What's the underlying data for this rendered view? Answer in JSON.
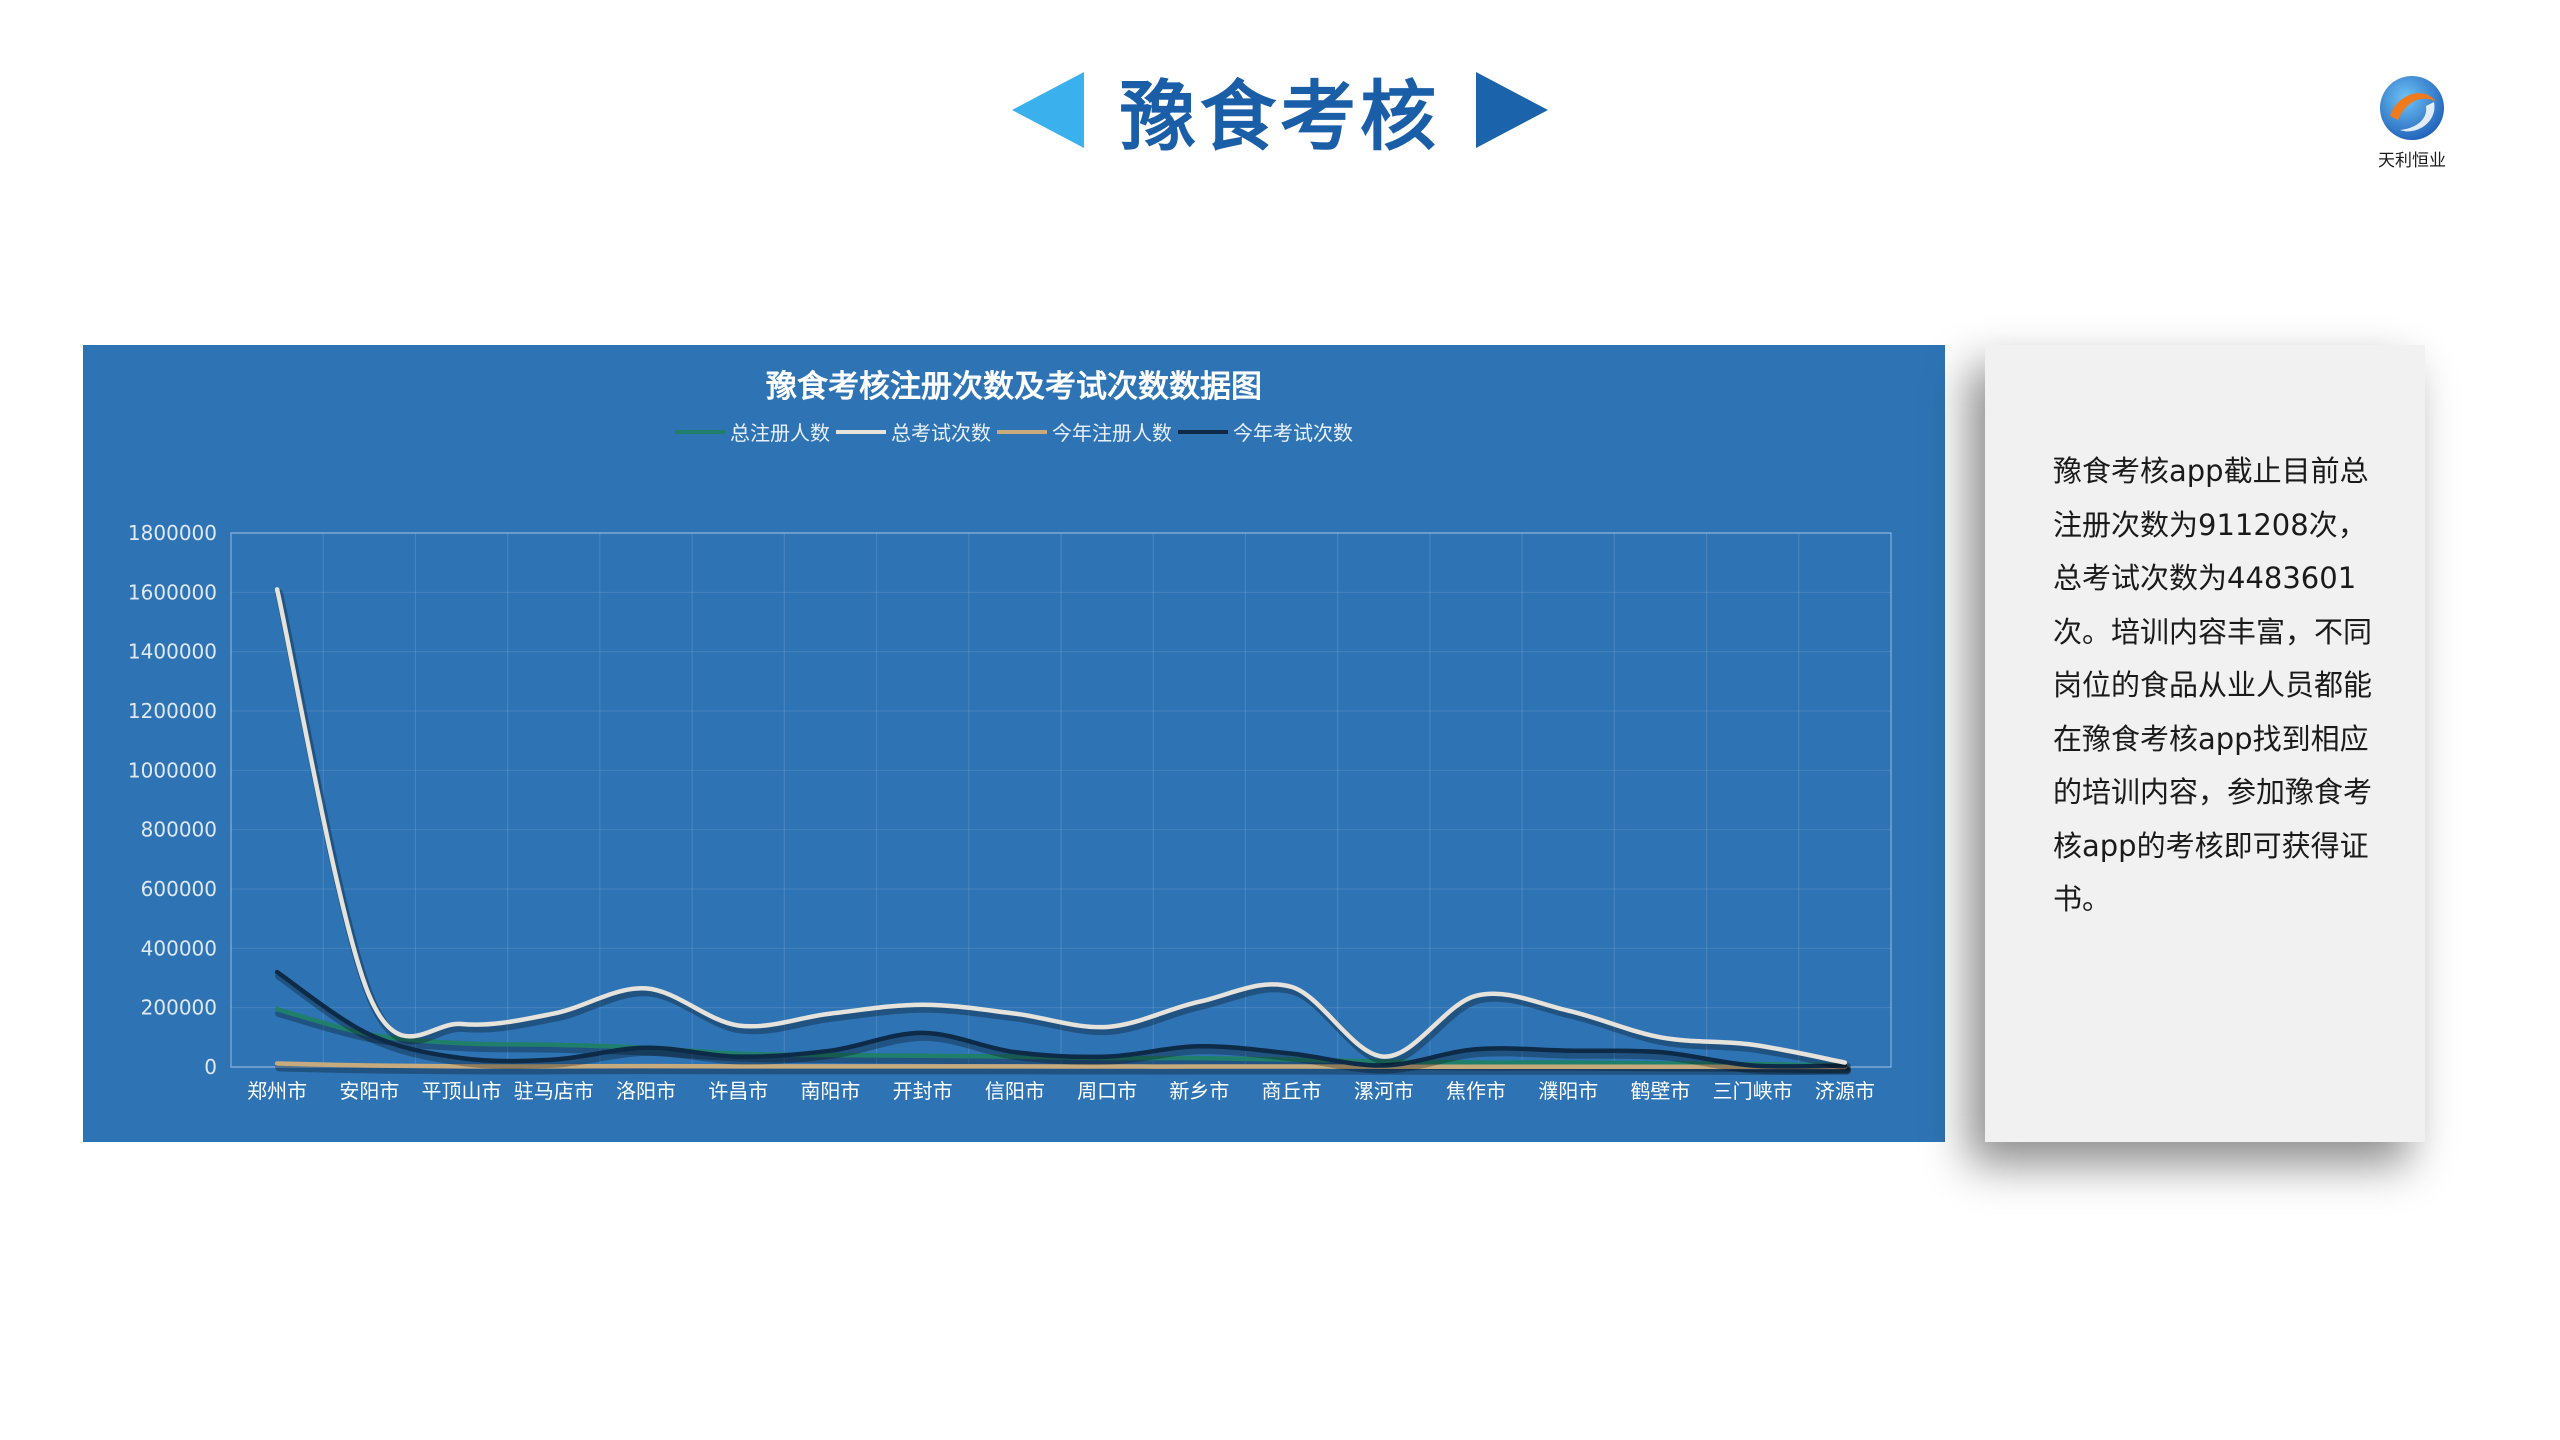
{
  "header": {
    "title": "豫食考核"
  },
  "logo": {
    "text": "天利恒业",
    "accent_colors": [
      "#1e5fb8",
      "#f07a1c",
      "#3ab0ec"
    ]
  },
  "colors": {
    "panel_bg": "#2e74b5",
    "title_blue": "#1b5ea8",
    "arrow_left": "#3ab0ec",
    "arrow_right": "#1b64ac"
  },
  "chart_data": {
    "type": "line",
    "title": "豫食考核注册次数及考试次数数据图",
    "xlabel": "",
    "ylabel": "",
    "ylim": [
      0,
      1800000
    ],
    "yticks": [
      "0",
      "200000",
      "400000",
      "600000",
      "800000",
      "1000000",
      "1200000",
      "1400000",
      "1600000",
      "1800000"
    ],
    "grid": true,
    "legend_position": "top-center",
    "categories": [
      "郑州市",
      "安阳市",
      "平顶山市",
      "驻马店市",
      "洛阳市",
      "许昌市",
      "南阳市",
      "开封市",
      "信阳市",
      "周口市",
      "新乡市",
      "商丘市",
      "漯河市",
      "焦作市",
      "濮阳市",
      "鹤壁市",
      "三门峡市",
      "济源市"
    ],
    "series": [
      {
        "name": "总注册人数",
        "color": "#1f7f6b",
        "values": [
          195000,
          110000,
          80000,
          75000,
          65000,
          45000,
          40000,
          38000,
          35000,
          30000,
          30000,
          25000,
          18000,
          15000,
          15000,
          12000,
          10000,
          5000
        ]
      },
      {
        "name": "总考试次数",
        "color": "#e6e2dc",
        "values": [
          1610000,
          240000,
          145000,
          180000,
          265000,
          140000,
          180000,
          210000,
          180000,
          135000,
          220000,
          270000,
          35000,
          240000,
          190000,
          100000,
          75000,
          15000
        ]
      },
      {
        "name": "今年注册人数",
        "color": "#c8ab7d",
        "values": [
          12000,
          5000,
          2000,
          2000,
          3000,
          2000,
          2000,
          2000,
          2000,
          1500,
          1500,
          1500,
          1000,
          1000,
          1000,
          800,
          500,
          300
        ]
      },
      {
        "name": "今年考试次数",
        "color": "#0d2a47",
        "values": [
          320000,
          110000,
          30000,
          25000,
          65000,
          35000,
          55000,
          115000,
          50000,
          35000,
          70000,
          45000,
          5000,
          60000,
          55000,
          50000,
          5000,
          5000
        ]
      }
    ]
  },
  "side": {
    "text": "豫食考核app截止目前总注册次数为911208次，总考试次数为4483601次。培训内容丰富，不同岗位的食品从业人员都能在豫食考核app找到相应的培训内容，参加豫食考核app的考核即可获得证书。"
  }
}
